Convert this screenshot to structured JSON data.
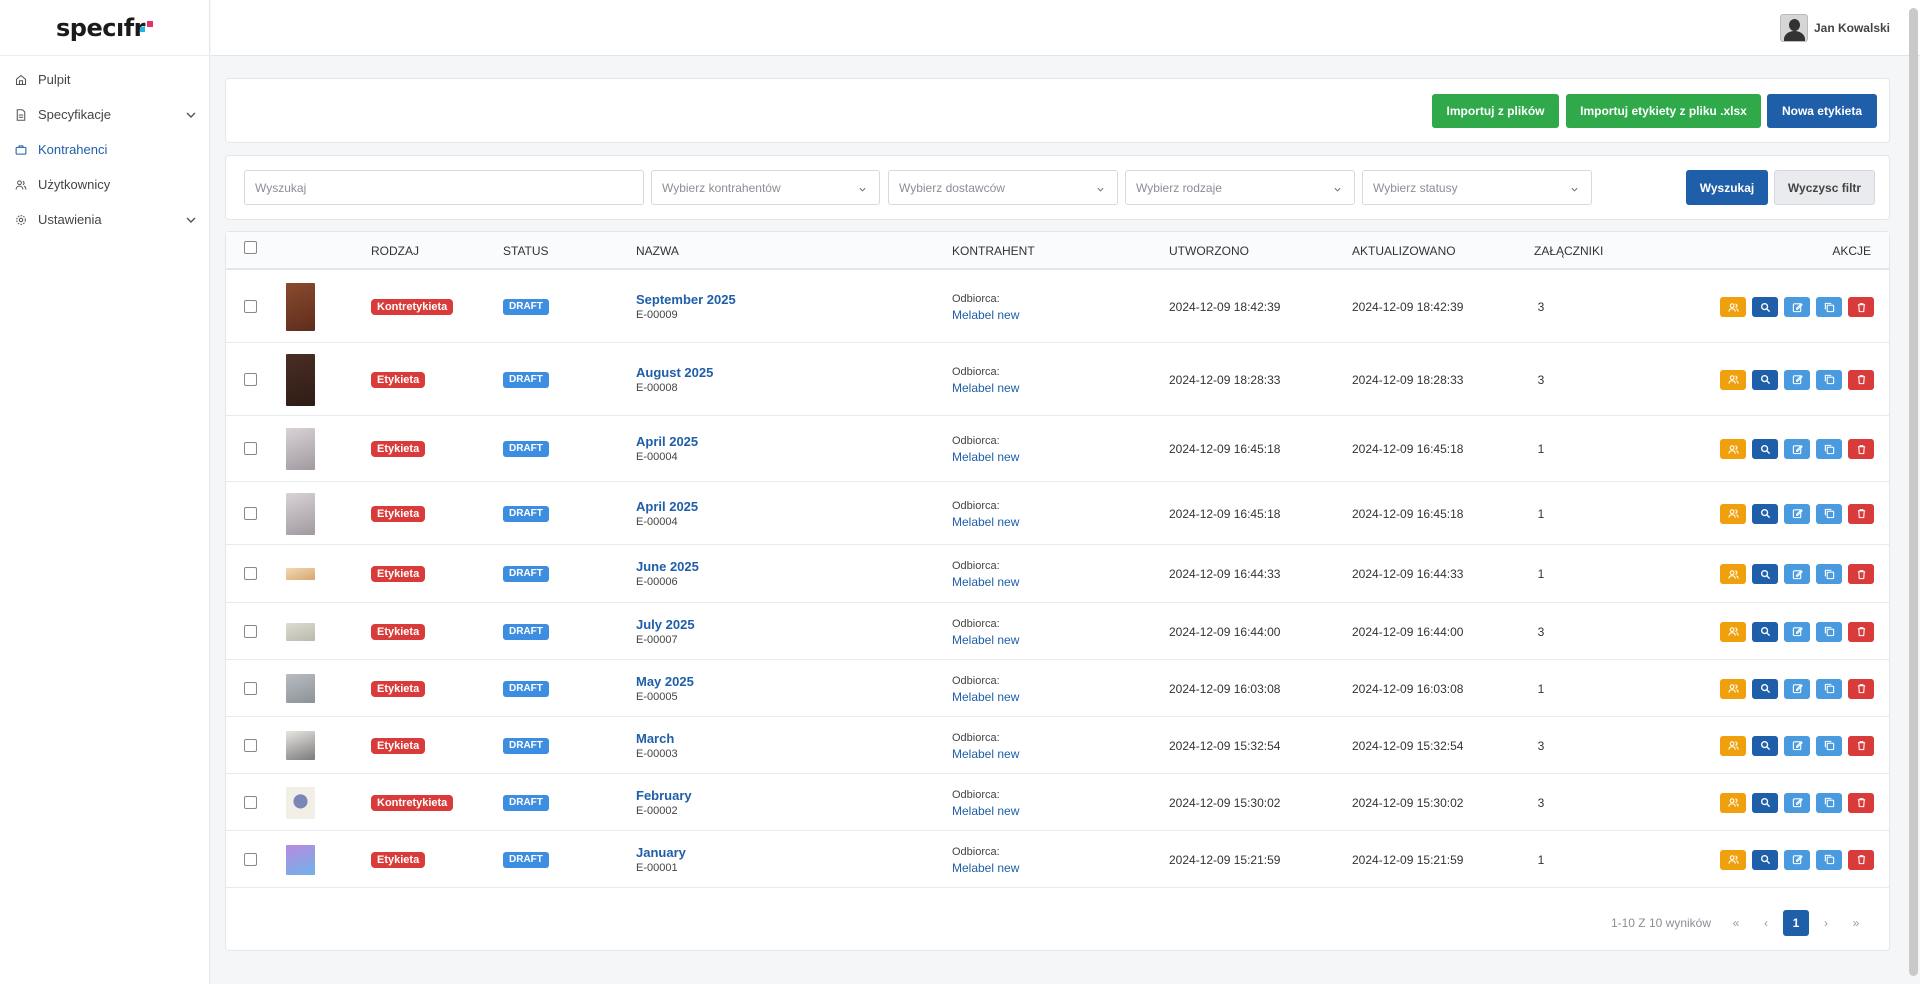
{
  "app": {
    "logo_text": "specıfr"
  },
  "sidebar": {
    "items": [
      {
        "label": "Pulpit",
        "icon": "home-icon",
        "active": false,
        "expandable": false
      },
      {
        "label": "Specyfikacje",
        "icon": "document-icon",
        "active": false,
        "expandable": true
      },
      {
        "label": "Kontrahenci",
        "icon": "briefcase-icon",
        "active": true,
        "expandable": false
      },
      {
        "label": "Użytkownicy",
        "icon": "users-icon",
        "active": false,
        "expandable": false
      },
      {
        "label": "Ustawienia",
        "icon": "gear-icon",
        "active": false,
        "expandable": true
      }
    ]
  },
  "header": {
    "user_name": "Jan Kowalski"
  },
  "actions": {
    "import_files": "Importuj z plików",
    "import_xlsx": "Importuj etykiety z pliku .xlsx",
    "new_label": "Nowa etykieta"
  },
  "filters": {
    "search_placeholder": "Wyszukaj",
    "contractors_placeholder": "Wybierz kontrahentów",
    "suppliers_placeholder": "Wybierz dostawców",
    "types_placeholder": "Wybierz rodzaje",
    "statuses_placeholder": "Wybierz statusy",
    "search_button": "Wyszukaj",
    "clear_button": "Wyczysc filtr"
  },
  "table": {
    "columns": {
      "type": "RODZAJ",
      "status": "STATUS",
      "name": "NAZWA",
      "contractor": "KONTRAHENT",
      "created": "UTWORZONO",
      "updated": "AKTUALIZOWANO",
      "attachments": "ZAŁĄCZNIKI",
      "actions": "AKCJE"
    },
    "rows": [
      {
        "type": "Kontretykieta",
        "status": "DRAFT",
        "name": "September 2025",
        "code": "E-00009",
        "contractor_label": "Odbiorca:",
        "contractor": "Melabel new",
        "created": "2024-12-09 18:42:39",
        "updated": "2024-12-09 18:42:39",
        "attachments": "3"
      },
      {
        "type": "Etykieta",
        "status": "DRAFT",
        "name": "August 2025",
        "code": "E-00008",
        "contractor_label": "Odbiorca:",
        "contractor": "Melabel new",
        "created": "2024-12-09 18:28:33",
        "updated": "2024-12-09 18:28:33",
        "attachments": "3"
      },
      {
        "type": "Etykieta",
        "status": "DRAFT",
        "name": "April 2025",
        "code": "E-00004",
        "contractor_label": "Odbiorca:",
        "contractor": "Melabel new",
        "created": "2024-12-09 16:45:18",
        "updated": "2024-12-09 16:45:18",
        "attachments": "1"
      },
      {
        "type": "Etykieta",
        "status": "DRAFT",
        "name": "April 2025",
        "code": "E-00004",
        "contractor_label": "Odbiorca:",
        "contractor": "Melabel new",
        "created": "2024-12-09 16:45:18",
        "updated": "2024-12-09 16:45:18",
        "attachments": "1"
      },
      {
        "type": "Etykieta",
        "status": "DRAFT",
        "name": "June 2025",
        "code": "E-00006",
        "contractor_label": "Odbiorca:",
        "contractor": "Melabel new",
        "created": "2024-12-09 16:44:33",
        "updated": "2024-12-09 16:44:33",
        "attachments": "1"
      },
      {
        "type": "Etykieta",
        "status": "DRAFT",
        "name": "July 2025",
        "code": "E-00007",
        "contractor_label": "Odbiorca:",
        "contractor": "Melabel new",
        "created": "2024-12-09 16:44:00",
        "updated": "2024-12-09 16:44:00",
        "attachments": "3"
      },
      {
        "type": "Etykieta",
        "status": "DRAFT",
        "name": "May 2025",
        "code": "E-00005",
        "contractor_label": "Odbiorca:",
        "contractor": "Melabel new",
        "created": "2024-12-09 16:03:08",
        "updated": "2024-12-09 16:03:08",
        "attachments": "1"
      },
      {
        "type": "Etykieta",
        "status": "DRAFT",
        "name": "March",
        "code": "E-00003",
        "contractor_label": "Odbiorca:",
        "contractor": "Melabel new",
        "created": "2024-12-09 15:32:54",
        "updated": "2024-12-09 15:32:54",
        "attachments": "3"
      },
      {
        "type": "Kontretykieta",
        "status": "DRAFT",
        "name": "February",
        "code": "E-00002",
        "contractor_label": "Odbiorca:",
        "contractor": "Melabel new",
        "created": "2024-12-09 15:30:02",
        "updated": "2024-12-09 15:30:02",
        "attachments": "3"
      },
      {
        "type": "Etykieta",
        "status": "DRAFT",
        "name": "January",
        "code": "E-00001",
        "contractor_label": "Odbiorca:",
        "contractor": "Melabel new",
        "created": "2024-12-09 15:21:59",
        "updated": "2024-12-09 15:21:59",
        "attachments": "1"
      }
    ]
  },
  "pagination": {
    "summary": "1-10 Z 10 wyników",
    "first": "«",
    "prev": "‹",
    "current": "1",
    "next": "›",
    "last": "»"
  },
  "colors": {
    "primary": "#1f5ea8",
    "success": "#2fa94a",
    "danger": "#d93a3a",
    "info": "#4a9ae0",
    "warning": "#f0a00c"
  }
}
